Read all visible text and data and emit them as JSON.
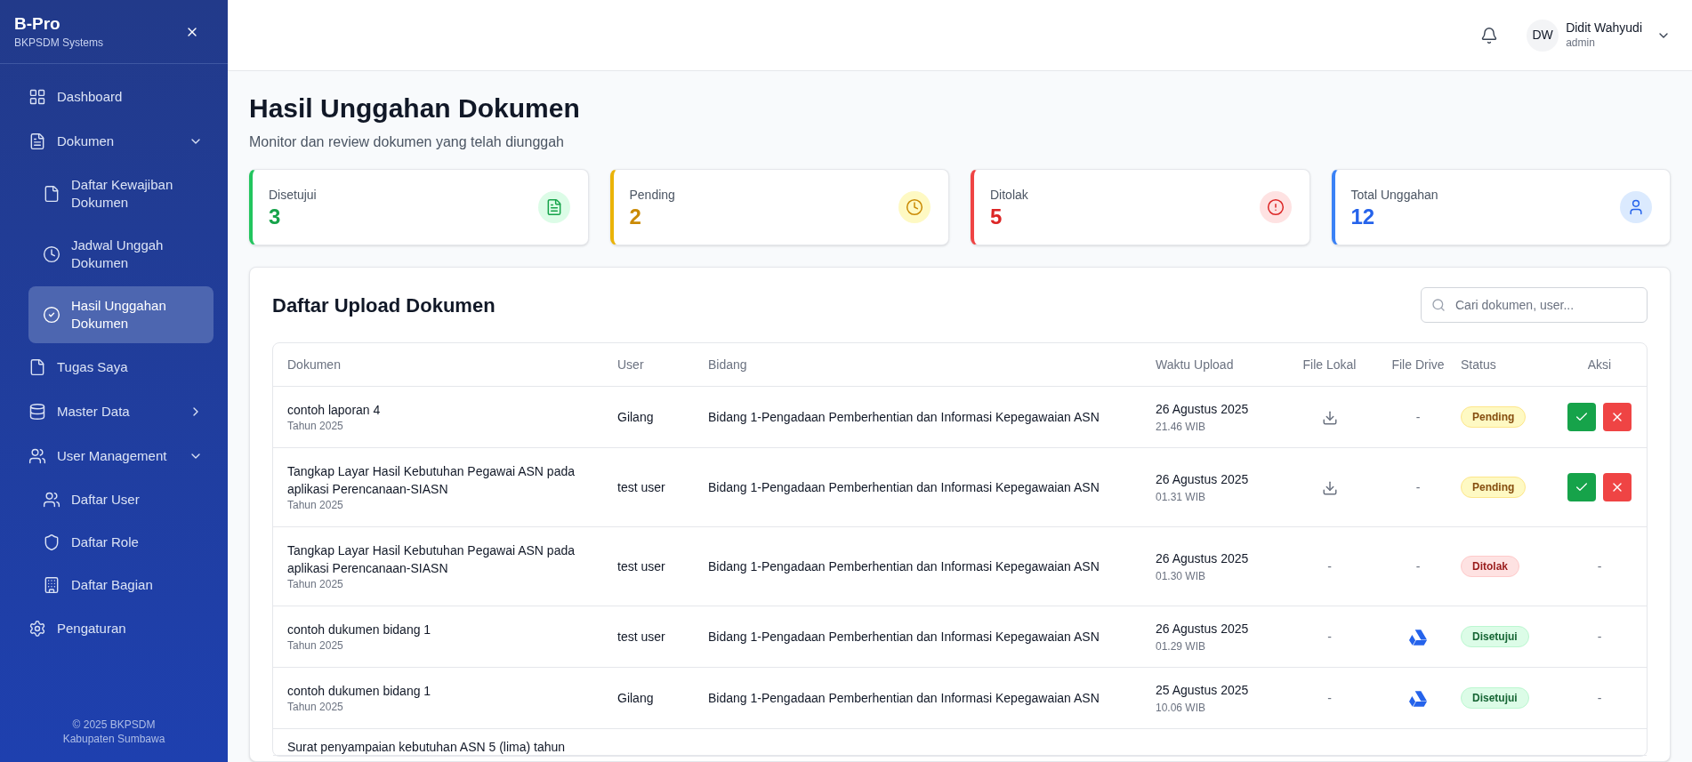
{
  "sidebar": {
    "brand": "B-Pro",
    "subtitle": "BKPSDM Systems",
    "items": [
      {
        "label": "Dashboard",
        "selected": false
      },
      {
        "label": "Dokumen",
        "selected": false,
        "expanded": true,
        "children": [
          {
            "label": "Daftar Kewajiban Dokumen",
            "selected": false
          },
          {
            "label": "Jadwal Unggah Dokumen",
            "selected": false
          },
          {
            "label": "Hasil Unggahan Dokumen",
            "selected": true
          }
        ]
      },
      {
        "label": "Tugas Saya",
        "selected": false
      },
      {
        "label": "Master Data",
        "selected": false,
        "expanded": false
      },
      {
        "label": "User Management",
        "selected": false,
        "expanded": true,
        "children": [
          {
            "label": "Daftar User",
            "selected": false
          },
          {
            "label": "Daftar Role",
            "selected": false
          },
          {
            "label": "Daftar Bagian",
            "selected": false
          }
        ]
      },
      {
        "label": "Pengaturan",
        "selected": false
      }
    ],
    "footer": [
      "© 2025 BKPSDM",
      "Kabupaten Sumbawa"
    ]
  },
  "header": {
    "initials": "DW",
    "name": "Didit Wahyudi",
    "role": "admin"
  },
  "page": {
    "title": "Hasil Unggahan Dokumen",
    "subtitle": "Monitor dan review dokumen yang telah diunggah"
  },
  "stats": [
    {
      "label": "Disetujui",
      "value": "3",
      "kind": "approved"
    },
    {
      "label": "Pending",
      "value": "2",
      "kind": "pending"
    },
    {
      "label": "Ditolak",
      "value": "5",
      "kind": "rejected"
    },
    {
      "label": "Total Unggahan",
      "value": "12",
      "kind": "total"
    }
  ],
  "table": {
    "title": "Daftar Upload Dokumen",
    "search": {
      "placeholder": "Cari dokumen, user..."
    },
    "columns": [
      "Dokumen",
      "User",
      "Bidang",
      "Waktu Upload",
      "File Lokal",
      "File Drive",
      "Status",
      "Aksi"
    ],
    "rows": [
      {
        "document": "contoh laporan 4",
        "year": "Tahun 2025",
        "user": "Gilang",
        "bidang": "Bidang 1-Pengadaan Pemberhentian dan Informasi Kepegawaian ASN",
        "date": "26 Agustus 2025",
        "time": "21.46 WIB",
        "file_local": {
          "kind": "download"
        },
        "file_drive": {
          "kind": "none",
          "text": "-"
        },
        "status": {
          "label": "Pending",
          "kind": "pending"
        },
        "actions": {
          "kind": "review"
        }
      },
      {
        "document": "Tangkap Layar Hasil Kebutuhan Pegawai ASN pada aplikasi Perencanaan-SIASN",
        "year": "Tahun 2025",
        "user": "test user",
        "bidang": "Bidang 1-Pengadaan Pemberhentian dan Informasi Kepegawaian ASN",
        "date": "26 Agustus 2025",
        "time": "01.31 WIB",
        "file_local": {
          "kind": "download"
        },
        "file_drive": {
          "kind": "none",
          "text": "-"
        },
        "status": {
          "label": "Pending",
          "kind": "pending"
        },
        "actions": {
          "kind": "review"
        }
      },
      {
        "document": "Tangkap Layar Hasil Kebutuhan Pegawai ASN pada aplikasi Perencanaan-SIASN",
        "year": "Tahun 2025",
        "user": "test user",
        "bidang": "Bidang 1-Pengadaan Pemberhentian dan Informasi Kepegawaian ASN",
        "date": "26 Agustus 2025",
        "time": "01.30 WIB",
        "file_local": {
          "kind": "none",
          "text": "-"
        },
        "file_drive": {
          "kind": "none",
          "text": "-"
        },
        "status": {
          "label": "Ditolak",
          "kind": "rejected"
        },
        "actions": {
          "kind": "none",
          "text": "-"
        }
      },
      {
        "document": "contoh dukumen bidang 1",
        "year": "Tahun 2025",
        "user": "test user",
        "bidang": "Bidang 1-Pengadaan Pemberhentian dan Informasi Kepegawaian ASN",
        "date": "26 Agustus 2025",
        "time": "01.29 WIB",
        "file_local": {
          "kind": "none",
          "text": "-"
        },
        "file_drive": {
          "kind": "drive"
        },
        "status": {
          "label": "Disetujui",
          "kind": "approved"
        },
        "actions": {
          "kind": "none",
          "text": "-"
        }
      },
      {
        "document": "contoh dukumen bidang 1",
        "year": "Tahun 2025",
        "user": "Gilang",
        "bidang": "Bidang 1-Pengadaan Pemberhentian dan Informasi Kepegawaian ASN",
        "date": "25 Agustus 2025",
        "time": "10.06 WIB",
        "file_local": {
          "kind": "none",
          "text": "-"
        },
        "file_drive": {
          "kind": "drive"
        },
        "status": {
          "label": "Disetujui",
          "kind": "approved"
        },
        "actions": {
          "kind": "none",
          "text": "-"
        }
      },
      {
        "document": "Surat penyampaian kebutuhan ASN 5 (lima) tahun"
      }
    ]
  }
}
